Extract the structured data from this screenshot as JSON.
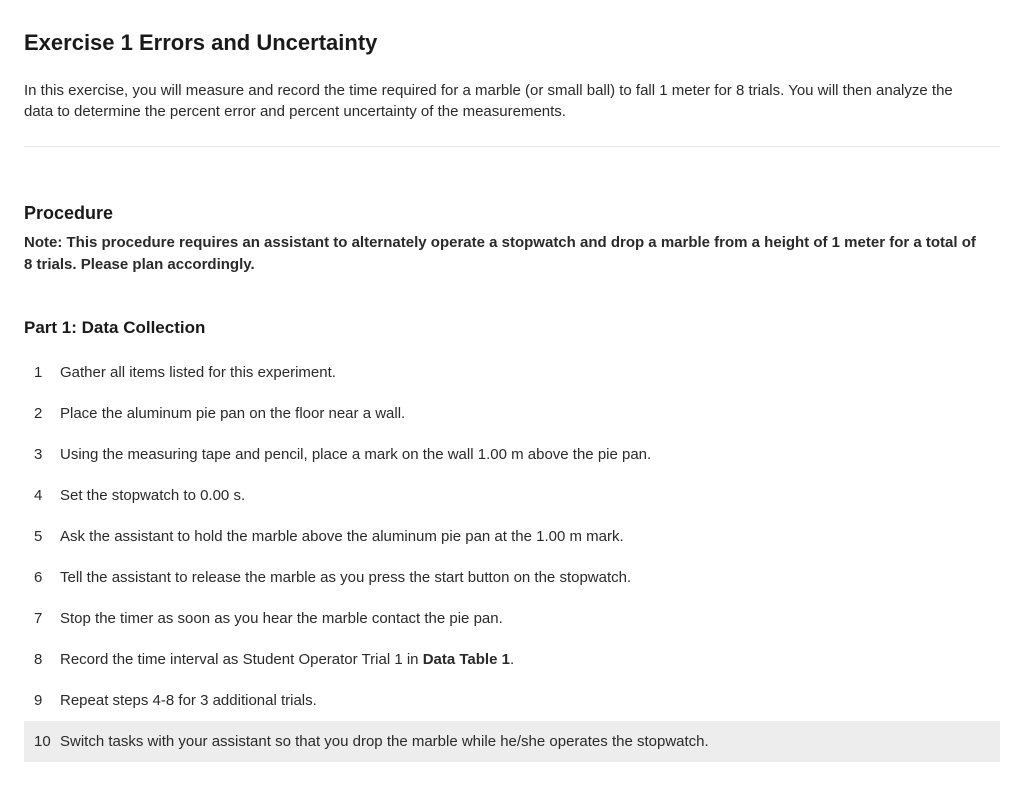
{
  "exercise": {
    "title": "Exercise 1 Errors and Uncertainty",
    "intro": "In this exercise, you will measure and record the time required for a marble (or small ball) to fall 1 meter for 8 trials. You will then analyze the data to determine the percent error and percent uncertainty of the measurements."
  },
  "procedure": {
    "heading": "Procedure",
    "note": "Note: This procedure requires an assistant to alternately operate a stopwatch and drop a marble from a height of 1 meter for a total of 8 trials. Please plan accordingly."
  },
  "part1": {
    "heading": "Part 1: Data Collection",
    "steps": [
      {
        "n": "1",
        "text": "Gather all items listed for this experiment."
      },
      {
        "n": "2",
        "text": "Place the aluminum pie pan on the floor near a wall."
      },
      {
        "n": "3",
        "text": "Using the measuring tape and pencil, place a mark on the wall 1.00 m above the pie pan."
      },
      {
        "n": "4",
        "text": "Set the stopwatch to 0.00 s."
      },
      {
        "n": "5",
        "text": "Ask the assistant to hold the marble above the aluminum pie pan at the 1.00 m mark."
      },
      {
        "n": "6",
        "text": "Tell the assistant to release the marble as you press the start button on the stopwatch."
      },
      {
        "n": "7",
        "text": "Stop the timer as soon as you hear the marble contact the pie pan."
      },
      {
        "n": "8",
        "pre": "Record the time interval as Student Operator Trial 1 in ",
        "bold": "Data Table 1",
        "post": "."
      },
      {
        "n": "9",
        "text": "Repeat steps 4-8 for 3 additional trials."
      },
      {
        "n": "10",
        "text": "Switch tasks with your assistant so that you drop the marble while he/she operates the stopwatch.",
        "highlight": true
      }
    ]
  }
}
